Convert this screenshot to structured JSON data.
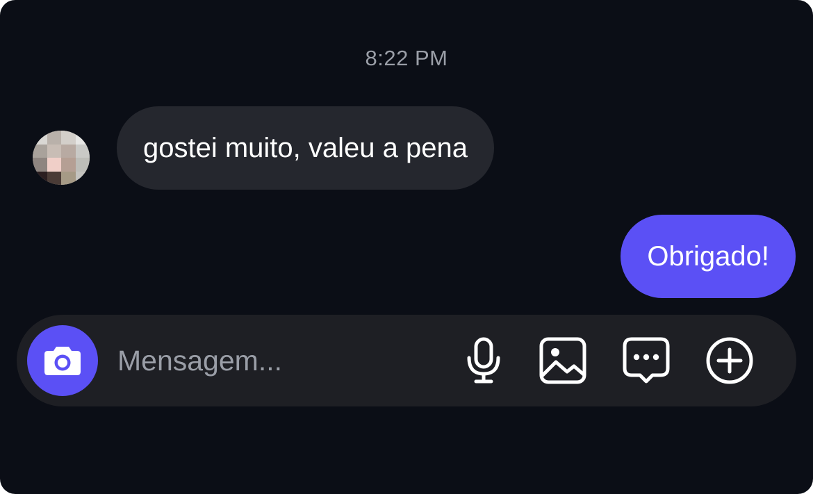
{
  "chat": {
    "timestamp": "8:22 PM",
    "messages": [
      {
        "direction": "incoming",
        "text": "gostei muito, valeu a pena"
      },
      {
        "direction": "outgoing",
        "text": "Obrigado!"
      }
    ]
  },
  "composer": {
    "placeholder": "Mensagem...",
    "value": "",
    "icons": [
      "camera-icon",
      "microphone-icon",
      "image-icon",
      "sticker-chat-icon",
      "add-circle-icon"
    ]
  },
  "colors": {
    "background": "#0b0e16",
    "incoming_bubble": "#25272e",
    "outgoing_bubble": "#5b50f5",
    "composer": "#1e1f24",
    "muted_text": "#9a9ea7"
  }
}
